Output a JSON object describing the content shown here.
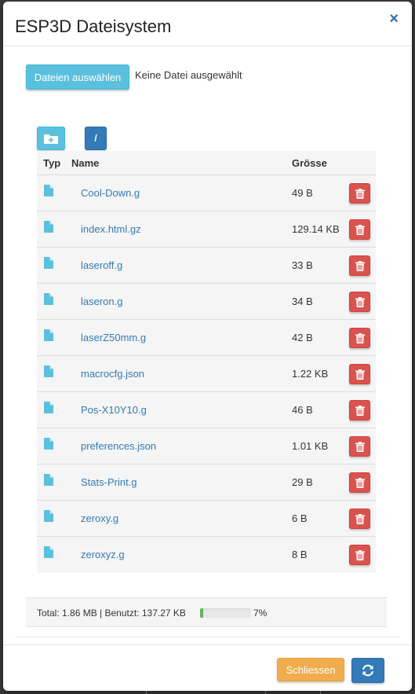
{
  "header": {
    "title": "ESP3D Dateisystem",
    "close_glyph": "×"
  },
  "upload": {
    "button_label": "Dateien auswählen",
    "status_text": "Keine Datei ausgewählt"
  },
  "toolbar": {
    "path_label": "/"
  },
  "table": {
    "headers": {
      "type": "Typ",
      "name": "Name",
      "size": "Grösse"
    },
    "rows": [
      {
        "name": "Cool-Down.g",
        "size": "49 B"
      },
      {
        "name": "index.html.gz",
        "size": "129.14 KB"
      },
      {
        "name": "laseroff.g",
        "size": "33 B"
      },
      {
        "name": "laseron.g",
        "size": "34 B"
      },
      {
        "name": "laserZ50mm.g",
        "size": "42 B"
      },
      {
        "name": "macrocfg.json",
        "size": "1.22 KB"
      },
      {
        "name": "Pos-X10Y10.g",
        "size": "46 B"
      },
      {
        "name": "preferences.json",
        "size": "1.01 KB"
      },
      {
        "name": "Stats-Print.g",
        "size": "29 B"
      },
      {
        "name": "zeroxy.g",
        "size": "6 B"
      },
      {
        "name": "zeroxyz.g",
        "size": "8 B"
      }
    ]
  },
  "storage": {
    "text": "Total: 1.86 MB  |  Benutzt: 137.27 KB",
    "used_percent": 7,
    "percent_label": "7%"
  },
  "footer": {
    "close_label": "Schliessen"
  },
  "icons": {
    "file": "file-icon",
    "folder_add": "folder-plus-icon",
    "delete": "trash-icon",
    "refresh": "refresh-icon"
  },
  "colors": {
    "info": "#5bc0de",
    "primary": "#337ab7",
    "danger": "#d9534f",
    "warning": "#f0ad4e",
    "success": "#5cb85c"
  }
}
